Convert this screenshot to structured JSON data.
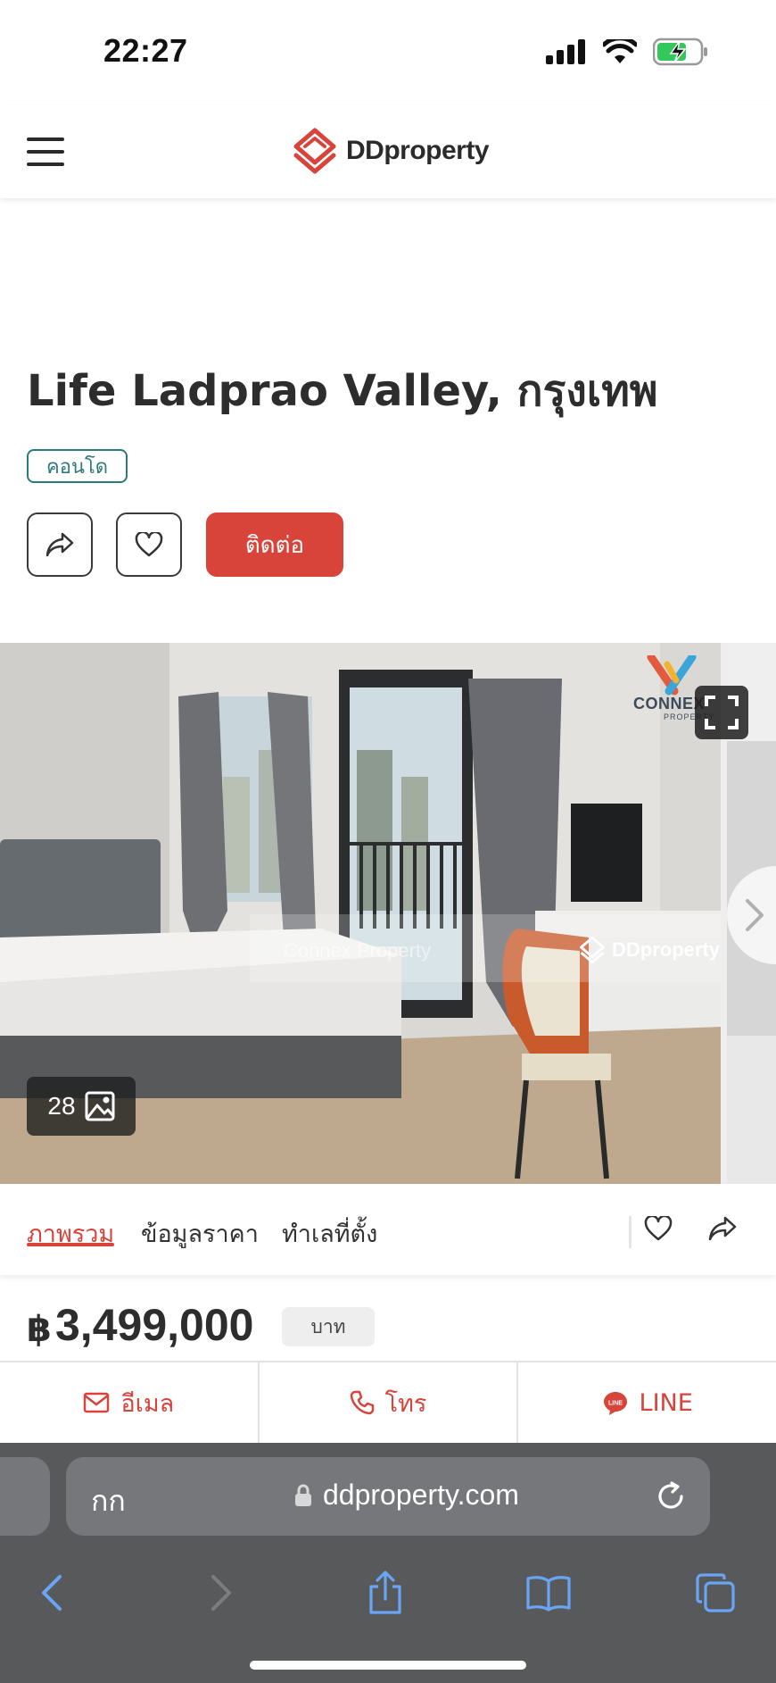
{
  "status_bar": {
    "time": "22:27"
  },
  "header": {
    "logo_text": "DDproperty",
    "brand_color": "#d8433a"
  },
  "listing": {
    "title": "Life Ladprao Valley, กรุงเทพ",
    "type_badge": "คอนโด",
    "contact_label": "ติดต่อ"
  },
  "gallery": {
    "photo_count": "28",
    "watermark_agency": "Connex Property",
    "watermark_brand": "DDproperty",
    "corner_brand": "CONNEX",
    "corner_brand_sub": "PROPERTY"
  },
  "tabs": [
    {
      "label": "ภาพรวม",
      "active": true
    },
    {
      "label": "ข้อมูลราคา",
      "active": false
    },
    {
      "label": "ทำเลที่ตั้ง",
      "active": false
    }
  ],
  "price": {
    "currency": "฿",
    "value": "3,499,000",
    "unit": "บาท"
  },
  "contact": {
    "email": "อีเมล",
    "phone": "โทร",
    "line": "LINE"
  },
  "browser": {
    "text_size": "กก",
    "url": "ddproperty.com"
  },
  "icons": {
    "share": "share-icon",
    "favorite": "heart-icon",
    "fullscreen": "fullscreen-icon",
    "gallery": "image-icon",
    "mail": "mail-icon",
    "phone": "phone-icon",
    "line": "line-icon",
    "lock": "lock-icon",
    "reload": "reload-icon",
    "back": "back-icon",
    "forward": "forward-icon",
    "share_sheet": "share-sheet-icon",
    "bookmarks": "book-icon",
    "tabs": "tabs-icon"
  }
}
